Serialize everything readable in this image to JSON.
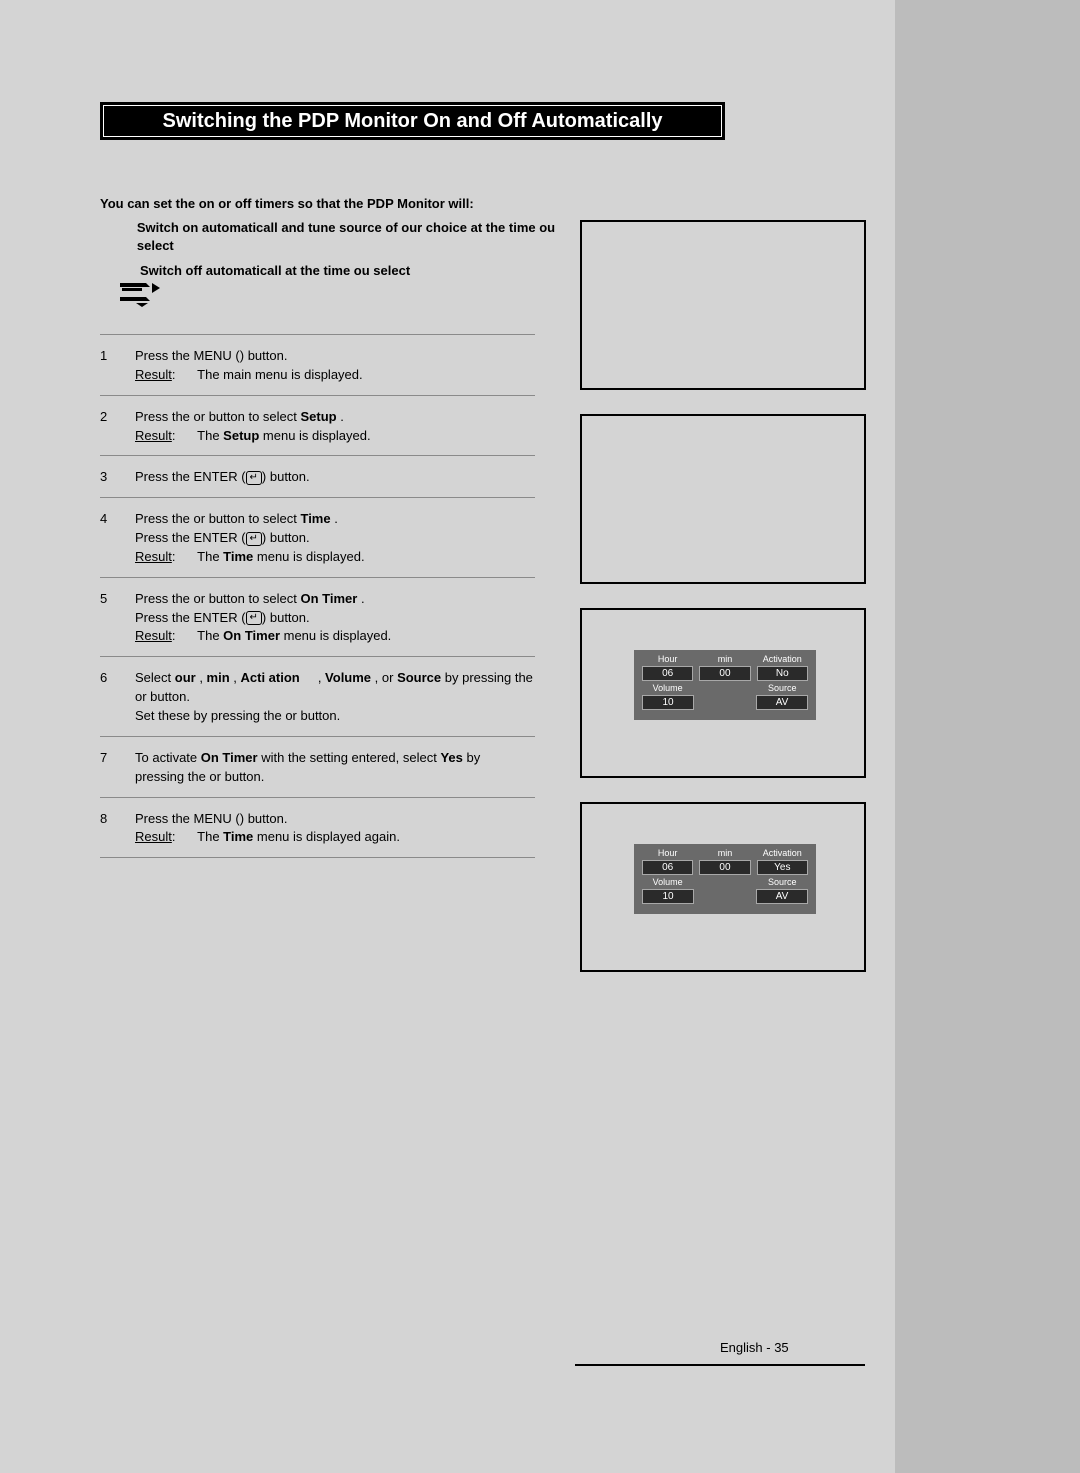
{
  "title": "Switching the PDP Monitor On and Off Automatically",
  "intro": {
    "lead": "You can set the on or off timers so that the PDP Monitor will:",
    "bullets": [
      "Switch on automaticall and tune source of our choice at the time ou select",
      "Switch off automaticall at the time ou select"
    ]
  },
  "steps": [
    {
      "num": "1",
      "line1_a": "Press the MENU (",
      "line1_b": ") button.",
      "result_label": "Result",
      "result_text": "The main menu is displayed."
    },
    {
      "num": "2",
      "line1_a": "Press the      or      button to select ",
      "setup_word": "Setup",
      "line1_b": " .",
      "result_label": "Result",
      "result_a": "The ",
      "setup_word2": "Setup",
      "result_b": "  menu is displayed."
    },
    {
      "num": "3",
      "line1_a": "Press the ENTER (",
      "line1_b": ") button."
    },
    {
      "num": "4",
      "line1_a": "Press the      or      button to select ",
      "time_word": "Time",
      "line1_b": " .",
      "line2_a": "Press the ENTER (",
      "line2_b": ") button.",
      "result_label": "Result",
      "result_a": "The ",
      "time_word2": "Time",
      "result_b": "  menu is displayed."
    },
    {
      "num": "5",
      "line1_a": "Press the      or      button to select ",
      "ontimer_word": "On Timer",
      "line1_b": " .",
      "line2_a": "Press the ENTER (",
      "line2_b": ") button.",
      "result_label": "Result",
      "result_a": "The ",
      "ontimer_word2": "On Timer",
      "result_b": "   menu is displayed."
    },
    {
      "num": "6",
      "line1_a": "Select  ",
      "w1": "our",
      "w2": "min",
      "w3": "Acti  ation",
      "w4": "Volume",
      "w5": "Source",
      "sep": " , ",
      "or_word": " or ",
      "line1_b": "   by pressing the",
      "line2": "   or      button.",
      "line3": "Set these by pressing the      or      button."
    },
    {
      "num": "7",
      "line1_a": "To activate ",
      "ontimer_word": "On Timer",
      "line1_mid": "   with the setting entered, select ",
      "yes_word": "Yes",
      "line1_b": "  by",
      "line2": "pressing the      or      button."
    },
    {
      "num": "8",
      "line1_a": "Press the MENU (",
      "line1_b": ") button.",
      "result_label": "Result",
      "result_a": "The ",
      "time_word": "Time",
      "result_b": "  menu is displayed again."
    }
  ],
  "osd": {
    "labels1": [
      "Hour",
      "min",
      "Activation"
    ],
    "labels2": [
      "Volume",
      "Source"
    ],
    "panel3": {
      "hour": "06",
      "min": "00",
      "activation": "No",
      "volume": "10",
      "source": "AV"
    },
    "panel4": {
      "hour": "06",
      "min": "00",
      "activation": "Yes",
      "volume": "10",
      "source": "AV"
    }
  },
  "footer": "English - 35",
  "menu_symbol": "",
  "note_symbol": ""
}
